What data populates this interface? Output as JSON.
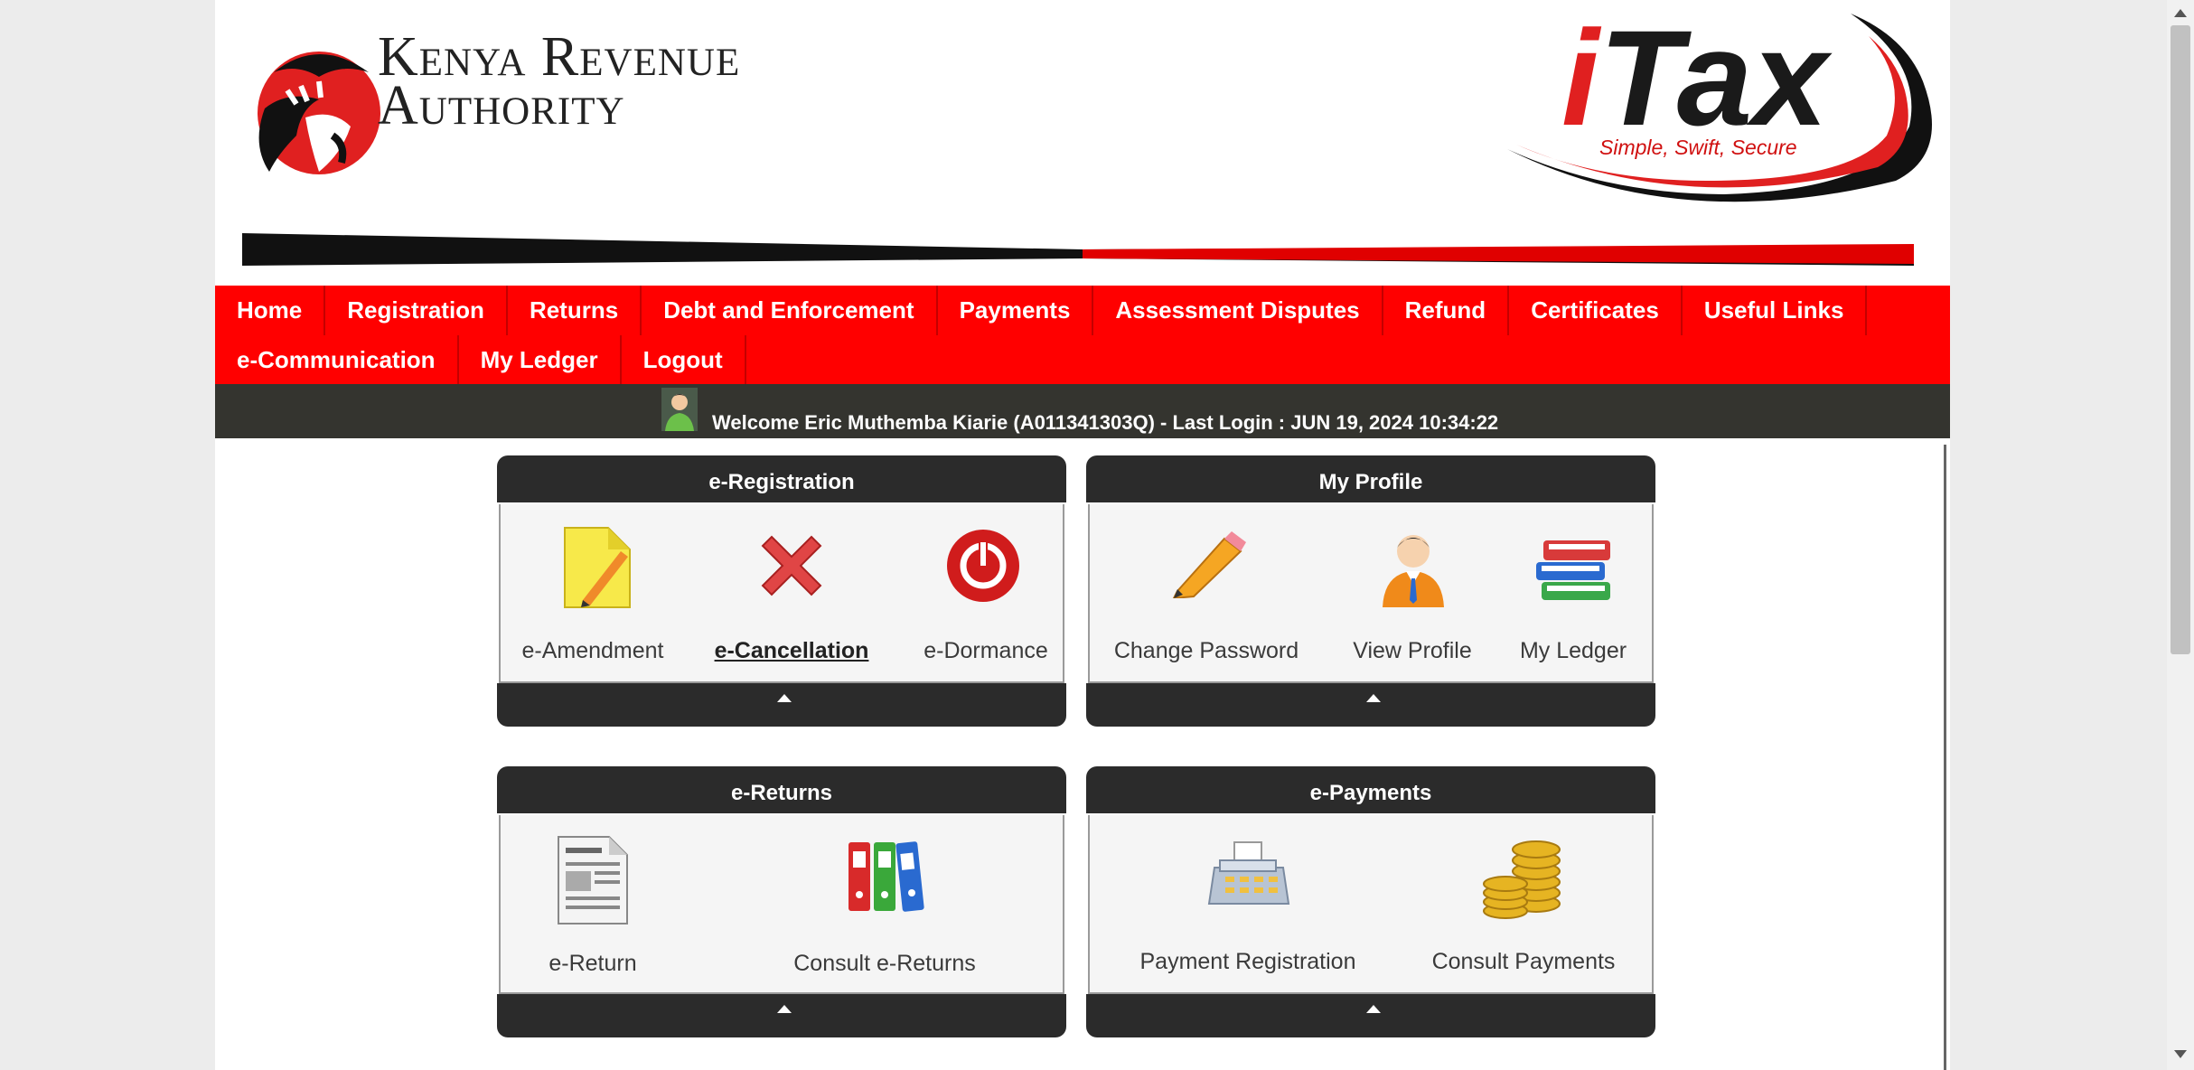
{
  "header": {
    "kra_line1": "Kenya Revenue",
    "kra_line2": "Authority",
    "itax_i": "i",
    "itax_tax": "Tax",
    "itax_tagline": "Simple, Swift, Secure"
  },
  "nav": {
    "row1": [
      "Home",
      "Registration",
      "Returns",
      "Debt and Enforcement",
      "Payments",
      "Assessment Disputes",
      "Refund",
      "Certificates",
      "Useful Links"
    ],
    "row2": [
      "e-Communication",
      "My Ledger",
      "Logout"
    ]
  },
  "welcome": {
    "text": "Welcome Eric Muthemba Kiarie (A011341303Q)  - Last Login : JUN 19, 2024 10:34:22"
  },
  "panels": {
    "registration": {
      "title": "e-Registration",
      "items": [
        "e-Amendment",
        "e-Cancellation",
        "e-Dormance"
      ],
      "active_item": "e-Cancellation"
    },
    "profile": {
      "title": "My Profile",
      "items": [
        "Change Password",
        "View Profile",
        "My Ledger"
      ]
    },
    "returns": {
      "title": "e-Returns",
      "items": [
        "e-Return",
        "Consult e-Returns"
      ]
    },
    "payments": {
      "title": "e-Payments",
      "items": [
        "Payment Registration",
        "Consult Payments"
      ]
    }
  },
  "colors": {
    "nav_bg": "#ff0000",
    "welcome_bg": "#34342f",
    "panel_head_bg": "#2b2b2b",
    "panel_body_bg": "#f5f5f5"
  },
  "icons": {
    "registration": [
      "note-pencil-icon",
      "red-x-icon",
      "power-icon"
    ],
    "profile": [
      "pencil-icon",
      "user-icon",
      "books-icon"
    ],
    "returns": [
      "document-icon",
      "binders-icon"
    ],
    "payments": [
      "cash-register-icon",
      "coins-icon"
    ]
  }
}
